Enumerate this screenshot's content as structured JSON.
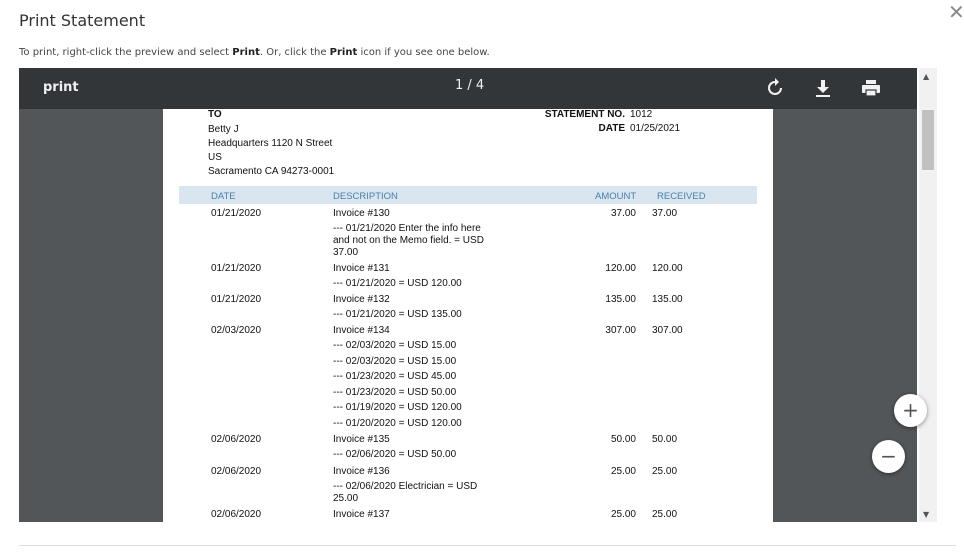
{
  "dialog": {
    "title": "Print Statement",
    "close_label": "✕",
    "instructions": {
      "part1": "To print, right-click the preview and select ",
      "bold1": "Print",
      "part2": ". Or, click the ",
      "bold2": "Print",
      "part3": " icon if you see one below."
    }
  },
  "viewer": {
    "title": "print",
    "page_indicator": "1 / 4",
    "icons": [
      "rotate-icon",
      "download-icon",
      "printer-icon"
    ],
    "zoom_in": "+",
    "zoom_out": "−",
    "colors": {
      "toolbar": "#323639",
      "background": "#525659"
    }
  },
  "statement": {
    "to_label": "TO",
    "customer": {
      "name": "Betty J",
      "address1": "Headquarters 1120 N Street",
      "country": "US",
      "city": "Sacramento CA 94273-0001"
    },
    "statement_no_label": "STATEMENT NO.",
    "statement_no": "1012",
    "date_label": "DATE",
    "date": "01/25/2021",
    "columns": [
      "DATE",
      "DESCRIPTION",
      "AMOUNT",
      "RECEIVED"
    ],
    "rows": [
      {
        "date": "01/21/2020",
        "invoice": "Invoice #130",
        "details": [
          "--- 01/21/2020 Enter the info here",
          "and not on the Memo field. = USD",
          "37.00"
        ],
        "amount": "37.00",
        "received": "37.00"
      },
      {
        "date": "01/21/2020",
        "invoice": "Invoice #131",
        "details": [
          "--- 01/21/2020  = USD 120.00"
        ],
        "amount": "120.00",
        "received": "120.00"
      },
      {
        "date": "01/21/2020",
        "invoice": "Invoice #132",
        "details": [
          "--- 01/21/2020  = USD 135.00"
        ],
        "amount": "135.00",
        "received": "135.00"
      },
      {
        "date": "02/03/2020",
        "invoice": "Invoice #134",
        "details": [
          "--- 02/03/2020  = USD 15.00",
          "--- 02/03/2020  = USD 15.00",
          "--- 01/23/2020  = USD 45.00",
          "--- 01/23/2020  = USD 50.00",
          "--- 01/19/2020  = USD 120.00",
          "--- 01/20/2020  = USD 120.00"
        ],
        "amount": "307.00",
        "received": "307.00"
      },
      {
        "date": "02/06/2020",
        "invoice": "Invoice #135",
        "details": [
          "--- 02/06/2020  = USD 50.00"
        ],
        "amount": "50.00",
        "received": "50.00"
      },
      {
        "date": "02/06/2020",
        "invoice": "Invoice #136",
        "details": [
          "--- 02/06/2020 Electrician = USD",
          "25.00"
        ],
        "amount": "25.00",
        "received": "25.00"
      },
      {
        "date": "02/06/2020",
        "invoice": "Invoice #137",
        "details": [],
        "amount": "25.00",
        "received": "25.00"
      }
    ]
  }
}
